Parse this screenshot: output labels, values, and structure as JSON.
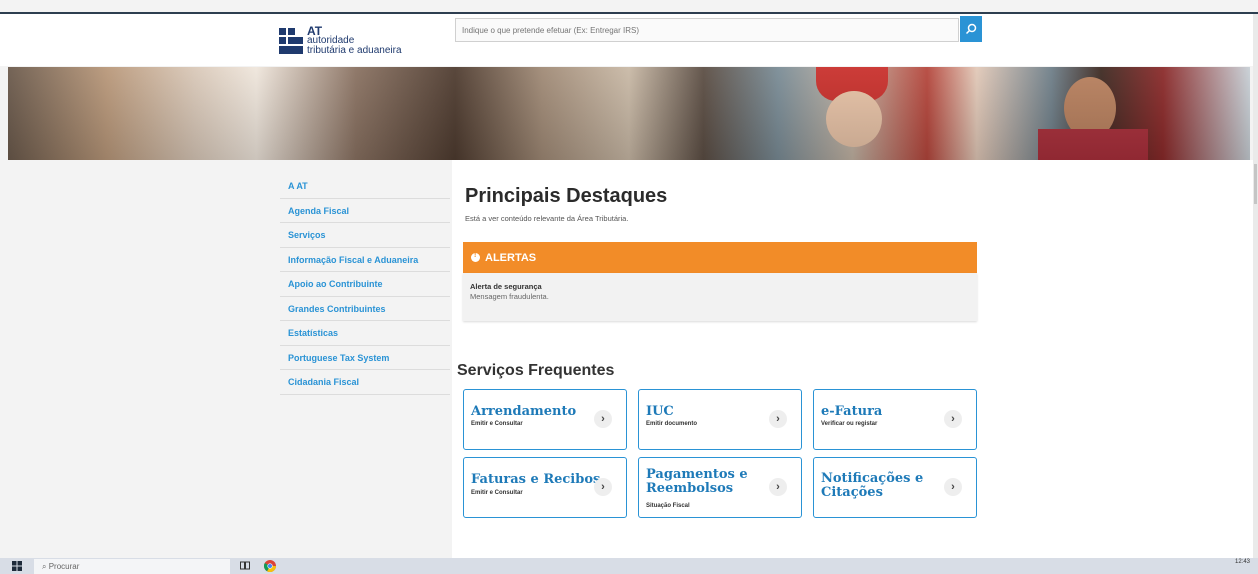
{
  "header": {
    "logo_line1": "AT",
    "logo_line2": "autoridade",
    "logo_line3": "tributária e aduaneira",
    "search_placeholder": "Indique o que pretende efetuar (Ex: Entregar IRS)"
  },
  "sidebar": {
    "items": [
      {
        "label": "A AT"
      },
      {
        "label": "Agenda Fiscal"
      },
      {
        "label": "Serviços"
      },
      {
        "label": "Informação Fiscal e Aduaneira"
      },
      {
        "label": "Apoio ao Contribuinte"
      },
      {
        "label": "Grandes Contribuintes"
      },
      {
        "label": "Estatísticas"
      },
      {
        "label": "Portuguese Tax System"
      },
      {
        "label": "Cidadania Fiscal"
      }
    ]
  },
  "main": {
    "title": "Principais Destaques",
    "subtitle": "Está a ver conteúdo relevante da Área Tributária.",
    "alert": {
      "header": "ALERTAS",
      "title": "Alerta de segurança",
      "desc": "Mensagem fraudulenta."
    },
    "services_title": "Serviços Frequentes",
    "cards": [
      {
        "name": "Arrendamento",
        "sub": "Emitir e Consultar"
      },
      {
        "name": "IUC",
        "sub": "Emitir documento"
      },
      {
        "name": "e-Fatura",
        "sub": "Verificar ou registar"
      },
      {
        "name": "Faturas e Recibos",
        "sub": "Emitir e Consultar"
      },
      {
        "name": "Pagamentos e Reembolsos",
        "sub": "Situação Fiscal"
      },
      {
        "name": "Notificações e Citações",
        "sub": ""
      }
    ]
  },
  "taskbar": {
    "search_label": "Procurar",
    "time": "12:43"
  },
  "colors": {
    "accent": "#2a93d5",
    "alert": "#f28c28",
    "brand": "#1f3a6e"
  }
}
